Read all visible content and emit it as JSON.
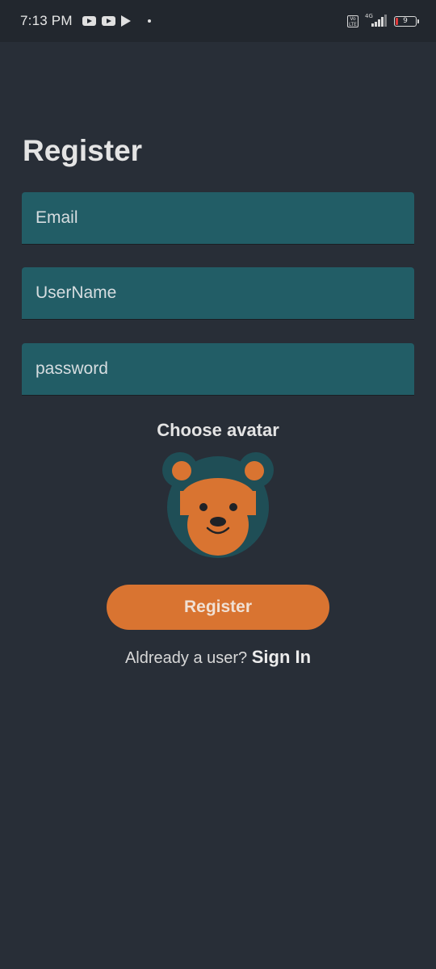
{
  "status_bar": {
    "time": "7:13 PM",
    "network": "4G",
    "volte": "Vo LTE",
    "battery_level": "9",
    "icons": [
      "youtube-icon",
      "youtube-icon",
      "play-store-icon",
      "dot-icon",
      "volte-icon",
      "signal-icon",
      "battery-icon"
    ]
  },
  "page": {
    "title": "Register"
  },
  "form": {
    "email": {
      "placeholder": "Email",
      "value": ""
    },
    "username": {
      "placeholder": "UserName",
      "value": ""
    },
    "password": {
      "placeholder": "password",
      "value": ""
    }
  },
  "avatar": {
    "label": "Choose avatar",
    "icon": "bear-avatar-icon"
  },
  "register_button": {
    "label": "Register"
  },
  "signin": {
    "prompt": "Aldready a user?",
    "link_label": "Sign In"
  },
  "colors": {
    "background": "#282e37",
    "status_bar": "#22272e",
    "field": "#225d66",
    "accent": "#d97431",
    "avatar_bg": "#1f4e56"
  }
}
